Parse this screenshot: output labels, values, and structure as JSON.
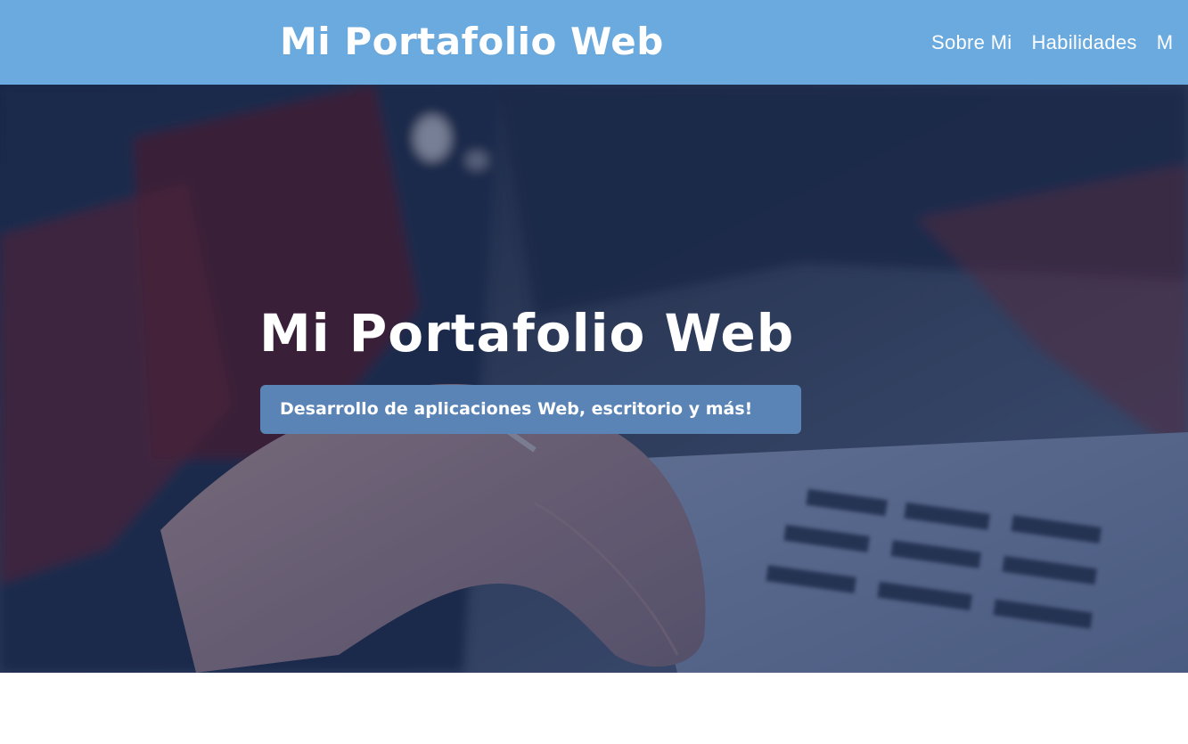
{
  "header": {
    "logo_text": "Mi Portafolio Web",
    "nav": [
      {
        "label": "Sobre Mi"
      },
      {
        "label": "Habilidades"
      },
      {
        "label": "M"
      }
    ]
  },
  "hero": {
    "title": "Mi Portafolio Web",
    "subtitle": "Desarrollo de aplicaciones Web, escritorio y más!"
  },
  "colors": {
    "header_bg": "#6aaadf",
    "badge_bg": "#5a84b5",
    "text": "#ffffff"
  }
}
